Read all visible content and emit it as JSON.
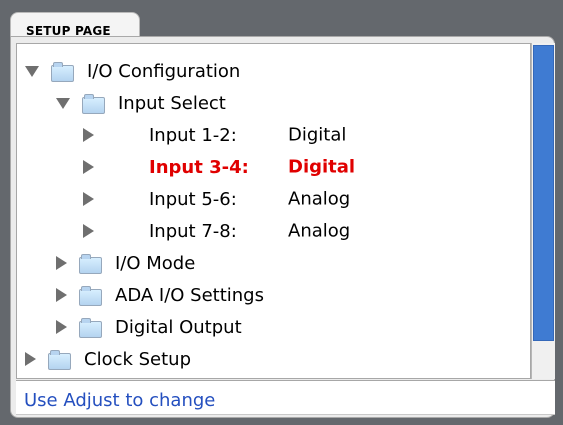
{
  "tab": {
    "label": "SETUP PAGE"
  },
  "tree": {
    "items": [
      {
        "label": "I/O Configuration",
        "expanded": true,
        "icon": "folder-icon",
        "level": 0
      },
      {
        "label": "Input Select",
        "expanded": true,
        "icon": "folder-icon",
        "level": 1
      },
      {
        "label": "Input 1-2:",
        "value": "Digital",
        "level": 2,
        "selected": false
      },
      {
        "label": "Input 3-4:",
        "value": "Digital",
        "level": 2,
        "selected": true
      },
      {
        "label": "Input 5-6:",
        "value": "Analog",
        "level": 2,
        "selected": false
      },
      {
        "label": "Input 7-8:",
        "value": "Analog",
        "level": 2,
        "selected": false
      },
      {
        "label": "I/O Mode",
        "expanded": false,
        "icon": "folder-icon",
        "level": 1
      },
      {
        "label": "ADA I/O Settings",
        "expanded": false,
        "icon": "folder-icon",
        "level": 1
      },
      {
        "label": "Digital Output",
        "expanded": false,
        "icon": "folder-icon",
        "level": 1
      },
      {
        "label": "Clock Setup",
        "expanded": false,
        "icon": "folder-icon",
        "level": 0
      }
    ]
  },
  "status": {
    "text": "Use Adjust to change"
  },
  "colors": {
    "background": "#64686d",
    "selected": "#e00000",
    "status_text": "#244fbf",
    "scroll_thumb": "#3f7bd2"
  }
}
